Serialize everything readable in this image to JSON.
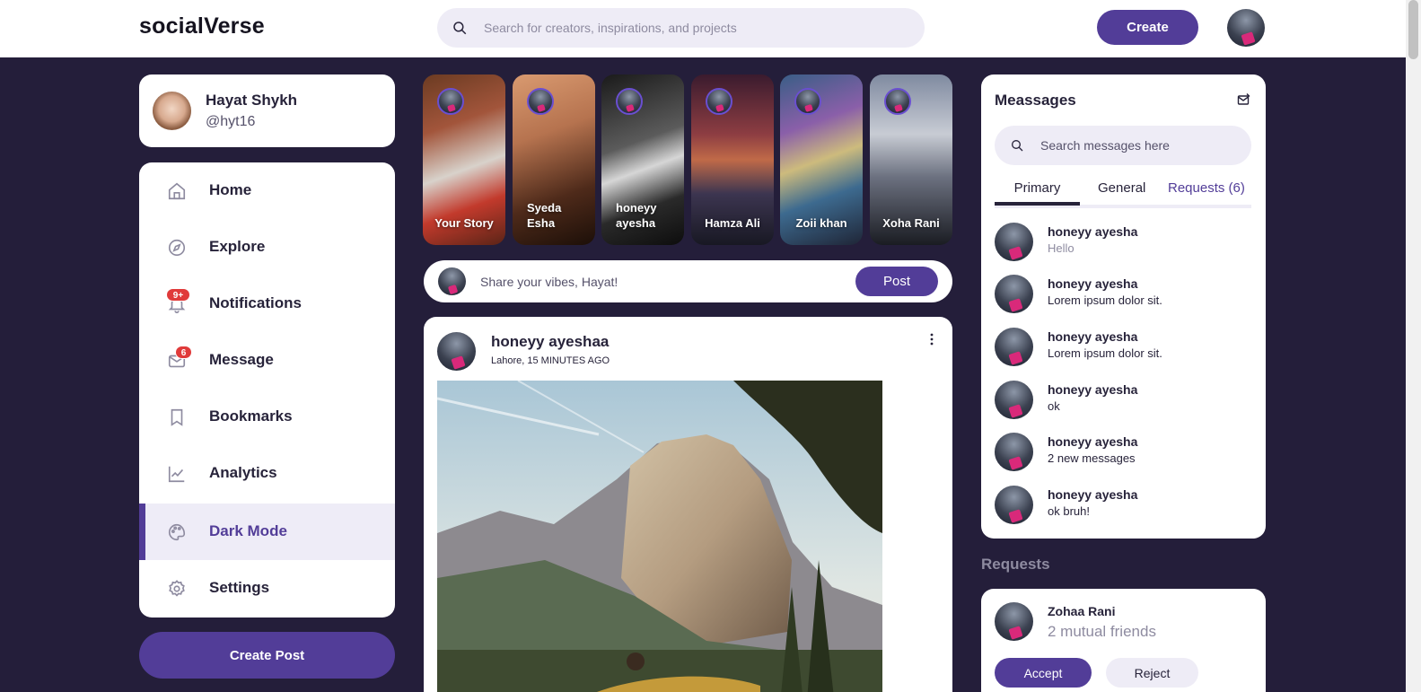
{
  "header": {
    "logo": "socialVerse",
    "search_placeholder": "Search for creators, inspirations, and projects",
    "create_label": "Create"
  },
  "profile": {
    "name": "Hayat Shykh",
    "handle": "@hyt16"
  },
  "nav": {
    "items": [
      {
        "label": "Home",
        "icon": "home-icon"
      },
      {
        "label": "Explore",
        "icon": "compass-icon"
      },
      {
        "label": "Notifications",
        "icon": "bell-icon",
        "badge": "9+"
      },
      {
        "label": "Message",
        "icon": "envelope-icon",
        "badge": "6"
      },
      {
        "label": "Bookmarks",
        "icon": "bookmark-icon"
      },
      {
        "label": "Analytics",
        "icon": "chart-line-icon"
      },
      {
        "label": "Dark Mode",
        "icon": "palette-icon",
        "active": true
      },
      {
        "label": "Settings",
        "icon": "gear-icon"
      }
    ],
    "create_post_label": "Create Post"
  },
  "stories": [
    {
      "name": "Your Story"
    },
    {
      "name": "Syeda Esha"
    },
    {
      "name": "honeyy ayesha"
    },
    {
      "name": "Hamza Ali"
    },
    {
      "name": "Zoii khan"
    },
    {
      "name": "Xoha Rani"
    }
  ],
  "composer": {
    "placeholder": "Share your vibes, Hayat!",
    "post_label": "Post"
  },
  "feed": [
    {
      "author": "honeyy ayeshaa",
      "meta": "Lahore, 15 MINUTES AGO"
    }
  ],
  "messages": {
    "title": "Meassages",
    "search_placeholder": "Search messages here",
    "tabs": [
      "Primary",
      "General",
      "Requests (6)"
    ],
    "list": [
      {
        "name": "honeyy ayesha",
        "text": "Hello"
      },
      {
        "name": "honeyy ayesha",
        "text": "Lorem ipsum dolor sit."
      },
      {
        "name": "honeyy ayesha",
        "text": "Lorem ipsum dolor sit."
      },
      {
        "name": "honeyy ayesha",
        "text": "ok"
      },
      {
        "name": "honeyy ayesha",
        "text": "2 new messages"
      },
      {
        "name": "honeyy ayesha",
        "text": "ok bruh!"
      }
    ]
  },
  "requests": {
    "heading": "Requests",
    "items": [
      {
        "name": "Zohaa Rani",
        "mutual": "2 mutual friends",
        "accept_label": "Accept",
        "reject_label": "Reject"
      }
    ]
  },
  "colors": {
    "accent": "#523d98",
    "page_bg": "#241e3a",
    "badge": "#e03a3a",
    "search_bg": "#eeecf6"
  }
}
